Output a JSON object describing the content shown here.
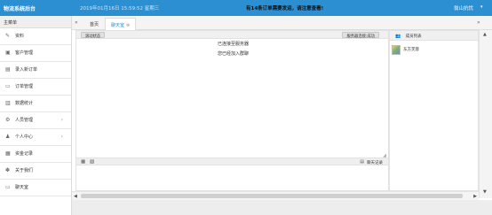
{
  "header": {
    "brand": "物流系统后台",
    "datetime": "2019年01月16日 15:59:52 星期三",
    "notice": "有14条订单需要发运，请注意查看!",
    "user": "翁山抗忧",
    "caret": "▾"
  },
  "sidebar": {
    "title": "主菜单",
    "items": [
      {
        "label": "资料",
        "icon": "✎",
        "arrow": ""
      },
      {
        "label": "客户管理",
        "icon": "▣",
        "arrow": ""
      },
      {
        "label": "录入新订单",
        "icon": "▤",
        "arrow": ""
      },
      {
        "label": "订单管理",
        "icon": "▭",
        "arrow": ""
      },
      {
        "label": "数据统计",
        "icon": "▥",
        "arrow": ""
      },
      {
        "label": "人员管理",
        "icon": "⚙",
        "arrow": "›"
      },
      {
        "label": "个人中心",
        "icon": "♟",
        "arrow": "›"
      },
      {
        "label": "资金记录",
        "icon": "▦",
        "arrow": ""
      },
      {
        "label": "关于我们",
        "icon": "✽",
        "arrow": ""
      },
      {
        "label": "聊天室",
        "icon": "▭",
        "arrow": ""
      }
    ]
  },
  "tabs": {
    "nav_left": "«",
    "nav_right": "»",
    "home": "首页",
    "active": "聊天室",
    "close": "⊗"
  },
  "chat": {
    "chip_left": "滚动状态",
    "chip_right": "服务器连接:成功",
    "messages": [
      "已连接至服务器",
      "您已经加入群聊"
    ],
    "resize_glyph": "◢",
    "toolbar_icons": [
      "▦",
      "▧"
    ],
    "history_label": "聊天记录",
    "history_icon": "▤"
  },
  "members": {
    "title": "成员列表",
    "title_icon": "👥",
    "list": [
      {
        "name": "东方芙蓉"
      }
    ]
  },
  "scroll": {
    "up": "▲",
    "down": "▼",
    "left": "◀",
    "right": "▶"
  }
}
